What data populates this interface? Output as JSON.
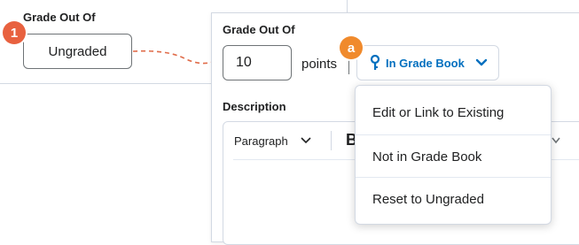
{
  "before": {
    "label": "Grade Out Of",
    "value": "Ungraded",
    "step_badge": "1"
  },
  "after": {
    "label": "Grade Out Of",
    "points_value": "10",
    "points_unit": "points",
    "step_badge": "a",
    "gradebook_button": "In Grade Book",
    "description_label": "Description",
    "toolbar": {
      "format_select": "Paragraph",
      "bold_glyph": "B"
    }
  },
  "dropdown": {
    "items": [
      "Edit or Link to Existing",
      "Not in Grade Book",
      "Reset to Ungraded"
    ]
  },
  "colors": {
    "accent_blue": "#006fbf",
    "badge_orange_red": "#e8613f",
    "badge_orange": "#f08a2c",
    "arrow_red": "#e06c4a"
  }
}
